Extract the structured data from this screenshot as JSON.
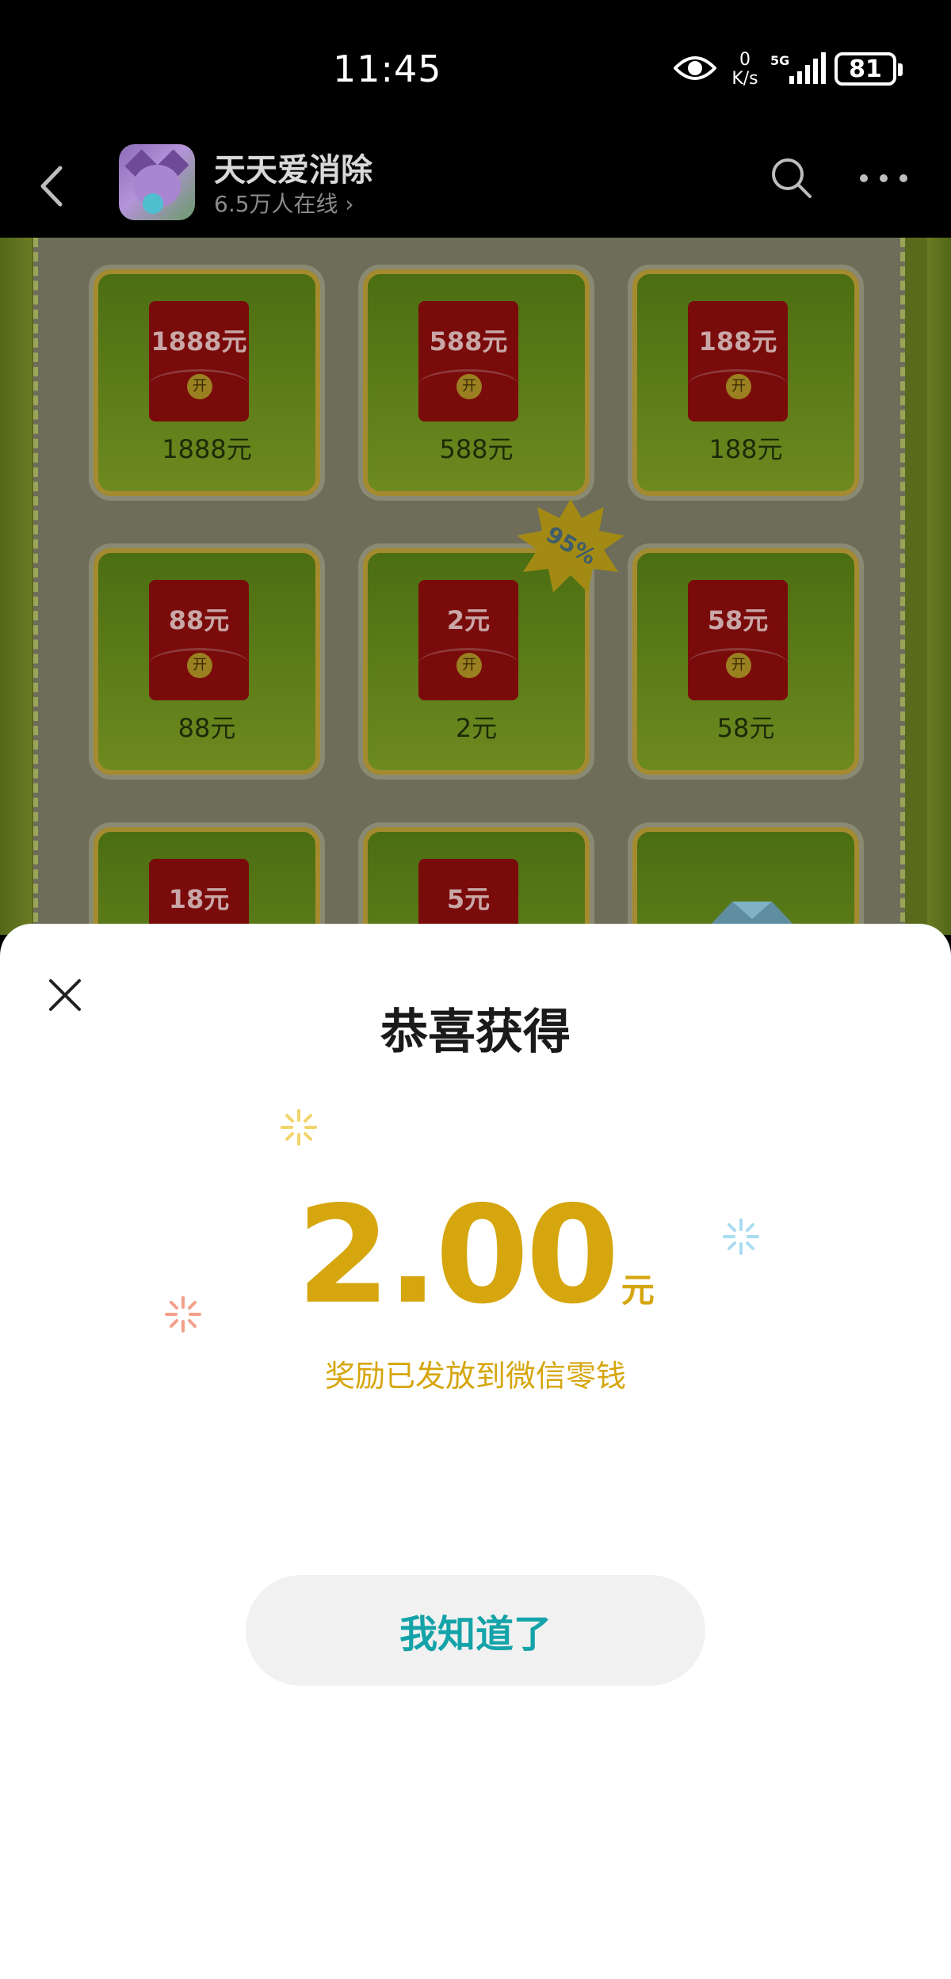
{
  "status_bar": {
    "time": "11:45",
    "net_speed_value": "0",
    "net_speed_unit": "K/s",
    "network": "5G",
    "battery": "81"
  },
  "app": {
    "title": "天天爱消除",
    "online": "6.5万人在线 ›"
  },
  "game": {
    "rows": [
      [
        {
          "env": "1888元",
          "label": "1888元"
        },
        {
          "env": "588元",
          "label": "588元"
        },
        {
          "env": "188元",
          "label": "188元"
        }
      ],
      [
        {
          "env": "88元",
          "label": "88元"
        },
        {
          "env": "2元",
          "label": "2元"
        },
        {
          "env": "58元",
          "label": "58元"
        }
      ],
      [
        {
          "env": "18元",
          "label": ""
        },
        {
          "env": "5元",
          "label": ""
        },
        {
          "env": "",
          "label": ""
        }
      ]
    ],
    "open_glyph": "开",
    "badge": "95%"
  },
  "modal": {
    "title": "恭喜获得",
    "amount": "2.00",
    "unit": "元",
    "message": "奖励已发放到微信零钱",
    "button": "我知道了"
  },
  "colors": {
    "gold": "#d6a60f",
    "button_text": "#13a3a8",
    "button_bg": "#f1f1f1"
  }
}
